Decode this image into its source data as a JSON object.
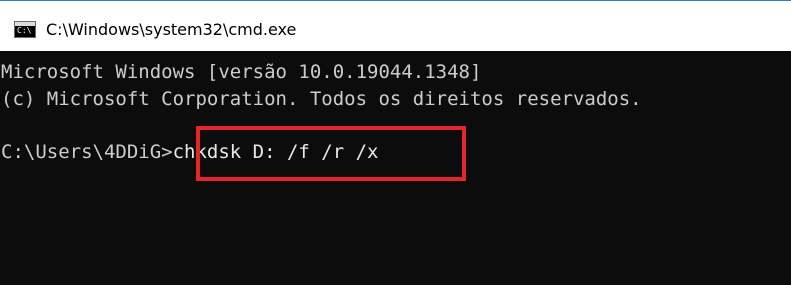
{
  "window": {
    "title": "C:\\Windows\\system32\\cmd.exe",
    "icon": "cmd-icon",
    "icon_text": "C:\\"
  },
  "console": {
    "line1": "Microsoft Windows [versão 10.0.19044.1348]",
    "line2": "(c) Microsoft Corporation. Todos os direitos reservados.",
    "prompt": "C:\\Users\\4DDiG>",
    "command": "chkdsk D: /f /r /x"
  },
  "colors": {
    "background": "#0c0c0c",
    "text": "#cccccc",
    "highlight_border": "#e52528",
    "titlebar": "#ffffff"
  }
}
